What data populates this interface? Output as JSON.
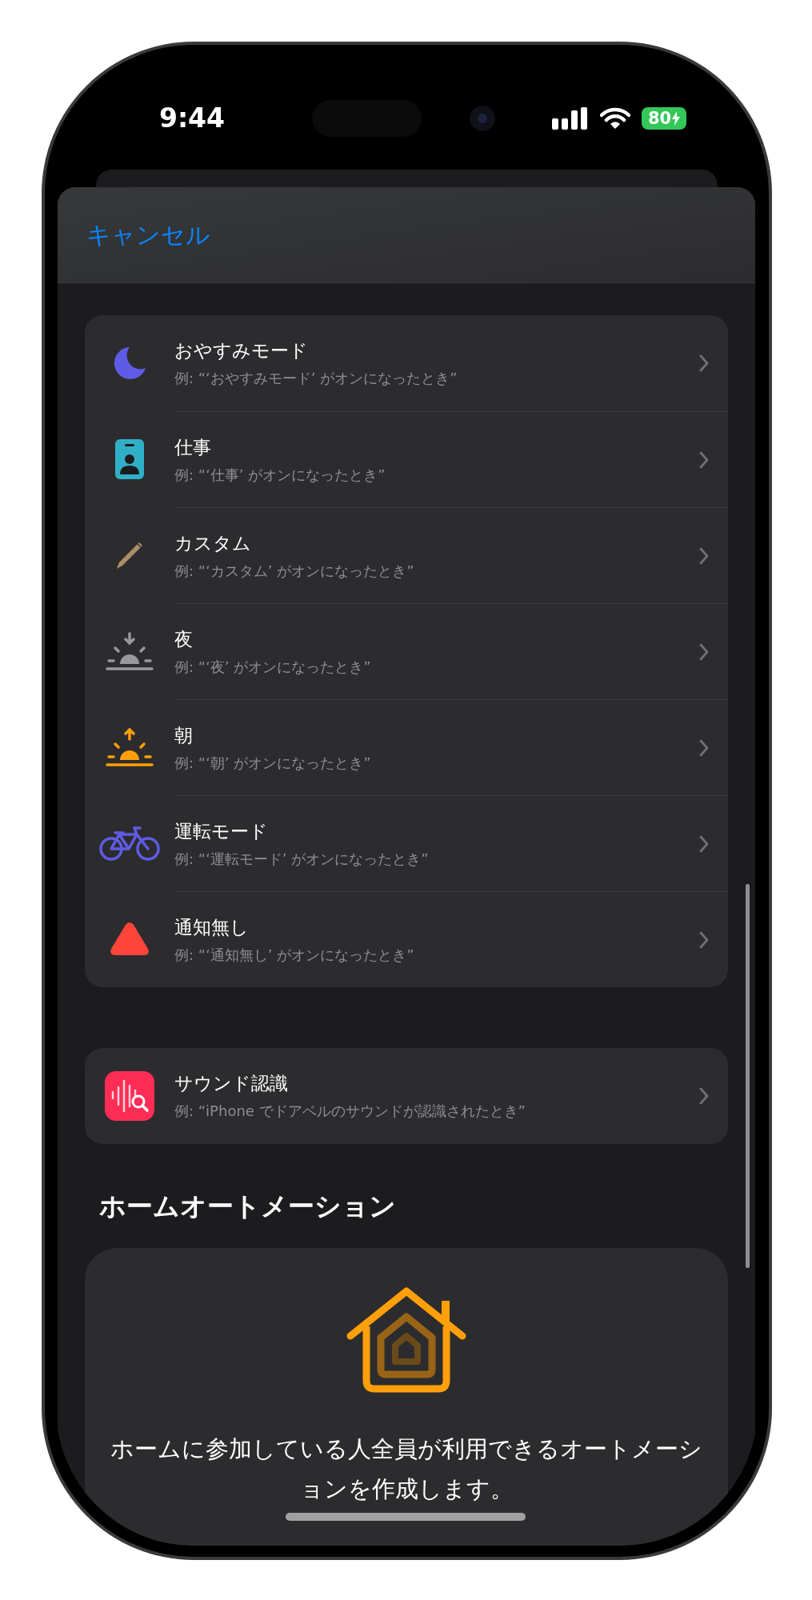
{
  "status_bar": {
    "time": "9:44",
    "battery": "80",
    "charging": true
  },
  "sheet": {
    "cancel": "キャンセル"
  },
  "focus_rows": [
    {
      "kind": "moon",
      "title": "おやすみモード",
      "subtitle": "例: “‘おやすみモード’ がオンになったとき”"
    },
    {
      "kind": "badge",
      "title": "仕事",
      "subtitle": "例: “‘仕事’ がオンになったとき”"
    },
    {
      "kind": "pencil",
      "title": "カスタム",
      "subtitle": "例: “‘カスタム’ がオンになったとき”"
    },
    {
      "kind": "sunset",
      "title": "夜",
      "subtitle": "例: “‘夜’ がオンになったとき”"
    },
    {
      "kind": "sunrise",
      "title": "朝",
      "subtitle": "例: “‘朝’ がオンになったとき”"
    },
    {
      "kind": "bicycle",
      "title": "運転モード",
      "subtitle": "例: “‘運転モード’ がオンになったとき”"
    },
    {
      "kind": "triangle",
      "title": "通知無し",
      "subtitle": "例: “‘通知無し’ がオンになったとき”"
    }
  ],
  "sound_rows": [
    {
      "kind": "sound",
      "title": "サウンド認識",
      "subtitle": "例: “iPhone でドアベルのサウンドが認識されたとき”"
    }
  ],
  "home_section": {
    "heading": "ホームオートメーション",
    "description": "ホームに参加している人全員が利用できるオートメーションを作成します。"
  }
}
